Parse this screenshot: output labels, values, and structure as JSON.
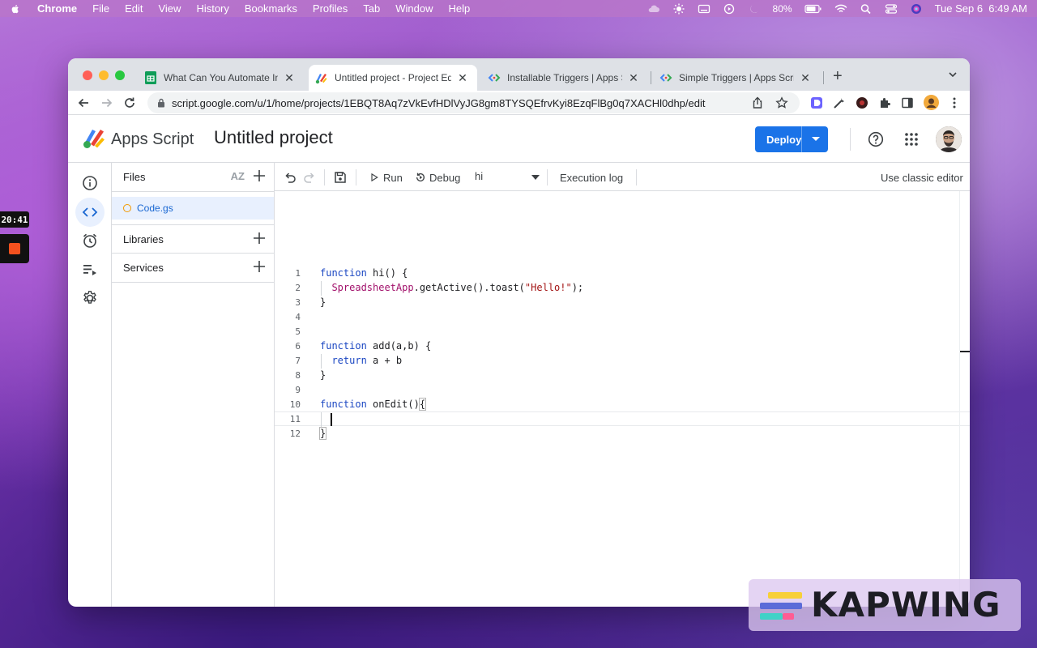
{
  "menubar": {
    "app": "Chrome",
    "items": [
      "File",
      "Edit",
      "View",
      "History",
      "Bookmarks",
      "Profiles",
      "Tab",
      "Window",
      "Help"
    ],
    "battery": "80%",
    "datetime": "Tue Sep 6  6:49 AM"
  },
  "recorder": {
    "timer": "20:41"
  },
  "browser": {
    "tabs": [
      {
        "title": "What Can You Automate In Goo",
        "icon": "sheets-icon",
        "active": false
      },
      {
        "title": "Untitled project - Project Editor",
        "icon": "apps-script-icon",
        "active": true
      },
      {
        "title": "Installable Triggers  |  Apps Scr",
        "icon": "code-icon",
        "active": false
      },
      {
        "title": "Simple Triggers  |  Apps Script",
        "icon": "code-icon",
        "active": false
      }
    ],
    "url": "script.google.com/u/1/home/projects/1EBQT8Aq7zVkEvfHDlVyJG8gm8TYSQEfrvKyi8EzqFlBg0q7XACHl0dhp/edit"
  },
  "app": {
    "product": "Apps Script",
    "project": "Untitled project",
    "deploy_label": "Deploy"
  },
  "files_panel": {
    "files_label": "Files",
    "sort_label": "AZ",
    "file_name": "Code.gs",
    "libraries_label": "Libraries",
    "services_label": "Services"
  },
  "editor_toolbar": {
    "run_label": "Run",
    "debug_label": "Debug",
    "function_selected": "hi",
    "execution_log_label": "Execution log",
    "classic_editor_label": "Use classic editor"
  },
  "code": {
    "line_numbers": [
      "1",
      "2",
      "3",
      "4",
      "5",
      "6",
      "7",
      "8",
      "9",
      "10",
      "11",
      "12"
    ],
    "lines": [
      "function hi() {",
      "  SpreadsheetApp.getActive().toast(\"Hello!\");",
      "}",
      "",
      "",
      "function add(a,b) {",
      "  return a + b",
      "}",
      "",
      "function onEdit(){",
      "  ",
      "}"
    ]
  },
  "watermark": {
    "text": "KAPWING"
  },
  "colors": {
    "accent": "#1a73e8",
    "keyword": "#1a46c2",
    "class": "#a2116b",
    "string": "#a31515"
  }
}
